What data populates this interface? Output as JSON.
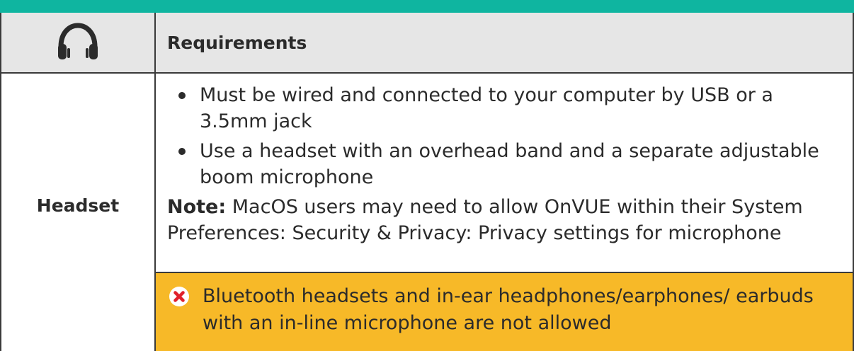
{
  "table": {
    "header": {
      "icon": "headphones-icon",
      "title": "Requirements"
    },
    "rows": [
      {
        "label": "Headset",
        "requirements": [
          "Must be wired and connected to your computer by USB or a 3.5mm jack",
          "Use a headset with an overhead band and a separate adjustable boom microphone"
        ],
        "note_label": "Note:",
        "note_text": " MacOS users may need to allow OnVUE within their System Preferences: Security & Privacy: Privacy settings for microphone",
        "warning": {
          "icon": "error-x-icon",
          "text": "Bluetooth headsets and in-ear headphones/earphones/ earbuds with an in-line microphone are not allowed"
        }
      }
    ]
  },
  "colors": {
    "accent_bar": "#0fb5a0",
    "header_bg": "#e6e6e6",
    "warning_bg": "#f7b928",
    "error_icon": "#e0212b"
  }
}
